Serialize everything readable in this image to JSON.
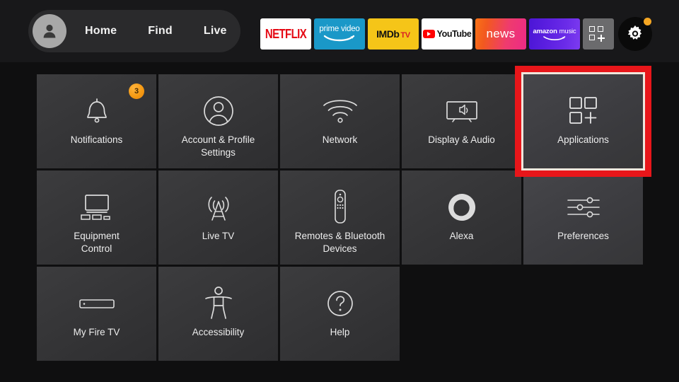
{
  "nav": {
    "avatar_name": "profile-avatar",
    "links": [
      {
        "label": "Home"
      },
      {
        "label": "Find"
      },
      {
        "label": "Live"
      }
    ],
    "apps": [
      {
        "name": "netflix",
        "label": "NETFLIX"
      },
      {
        "name": "prime-video",
        "label": "prime video"
      },
      {
        "name": "imdb-tv",
        "label": "IMDb",
        "label2": "TV"
      },
      {
        "name": "youtube",
        "label": "YouTube"
      },
      {
        "name": "news",
        "label": "news"
      },
      {
        "name": "amazon-music",
        "label": "amazon",
        "label2": "music"
      },
      {
        "name": "app-library",
        "label": ""
      },
      {
        "name": "settings-gear",
        "label": ""
      }
    ]
  },
  "grid": {
    "rows": [
      [
        {
          "name": "notifications",
          "label": "Notifications",
          "icon": "bell-icon",
          "badge": "3"
        },
        {
          "name": "account-profile",
          "label": "Account & Profile\nSettings",
          "icon": "person-circle-icon"
        },
        {
          "name": "network",
          "label": "Network",
          "icon": "wifi-icon"
        },
        {
          "name": "display-audio",
          "label": "Display & Audio",
          "icon": "tv-speaker-icon"
        },
        {
          "name": "applications",
          "label": "Applications",
          "icon": "apps-grid-plus-icon",
          "selected": true
        }
      ],
      [
        {
          "name": "equipment-control",
          "label": "Equipment\nControl",
          "icon": "tv-stand-icon"
        },
        {
          "name": "live-tv",
          "label": "Live TV",
          "icon": "antenna-icon"
        },
        {
          "name": "remotes-bluetooth",
          "label": "Remotes & Bluetooth\nDevices",
          "icon": "remote-icon"
        },
        {
          "name": "alexa",
          "label": "Alexa",
          "icon": "alexa-ring-icon"
        },
        {
          "name": "preferences",
          "label": "Preferences",
          "icon": "sliders-icon",
          "bright": true
        }
      ],
      [
        {
          "name": "my-fire-tv",
          "label": "My Fire TV",
          "icon": "fire-stick-icon"
        },
        {
          "name": "accessibility",
          "label": "Accessibility",
          "icon": "accessibility-icon"
        },
        {
          "name": "help",
          "label": "Help",
          "icon": "question-circle-icon"
        }
      ]
    ]
  },
  "colors": {
    "page_background": "#0f0f10",
    "nav_background": "#18181a",
    "tile_background": "#373739",
    "highlight_red": "#e8161a",
    "highlight_inner": "#efe6dc",
    "badge_orange": "#f59a14",
    "netflix_red": "#e50914",
    "prime_blue": "#1a98c8",
    "imdb_yellow": "#f5c518",
    "youtube_red": "#ff0000"
  }
}
